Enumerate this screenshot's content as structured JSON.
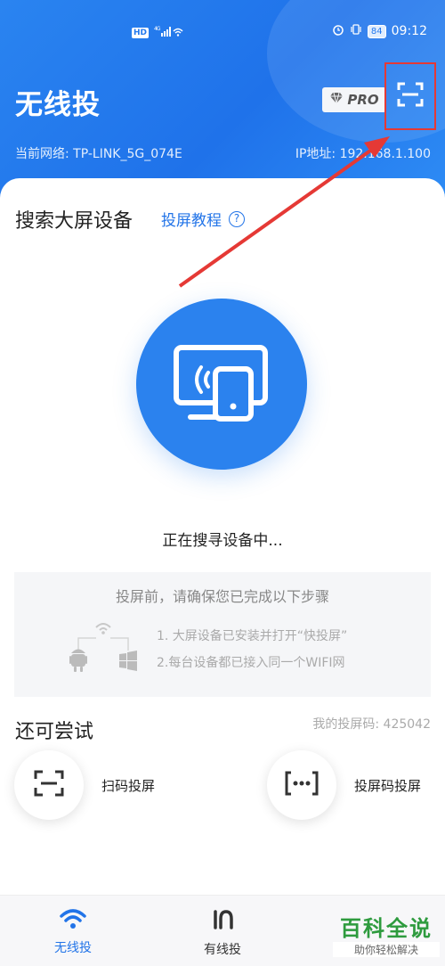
{
  "status_bar": {
    "hd": "HD",
    "signal": "4G",
    "battery": "84",
    "time": "09:12"
  },
  "header": {
    "title": "无线投",
    "pro_label": "PRO",
    "network_label": "当前网络: TP-LINK_5G_074E",
    "ip_label": "IP地址: 192.168.1.100"
  },
  "search_section": {
    "title": "搜索大屏设备",
    "tutorial_link": "投屏教程",
    "searching_text": "正在搜寻设备中..."
  },
  "steps": {
    "title": "投屏前，请确保您已完成以下步骤",
    "step1": "1. 大屏设备已安装并打开“快投屏”",
    "step2": "2.每台设备都已接入同一个WIFI网"
  },
  "try_section": {
    "title": "还可尝试",
    "my_code": "我的投屏码: 425042",
    "options": [
      {
        "label": "扫码投屏"
      },
      {
        "label": "投屏码投屏"
      }
    ]
  },
  "bottom_nav": {
    "items": [
      {
        "label": "无线投"
      },
      {
        "label": "有线投"
      }
    ]
  },
  "watermark": {
    "title": "百科全说",
    "subtitle": "助你轻松解决"
  },
  "colors": {
    "accent": "#2274e8",
    "header_bg": "#1f72ea",
    "highlight": "#e53935",
    "watermark": "#2e9b3e"
  }
}
